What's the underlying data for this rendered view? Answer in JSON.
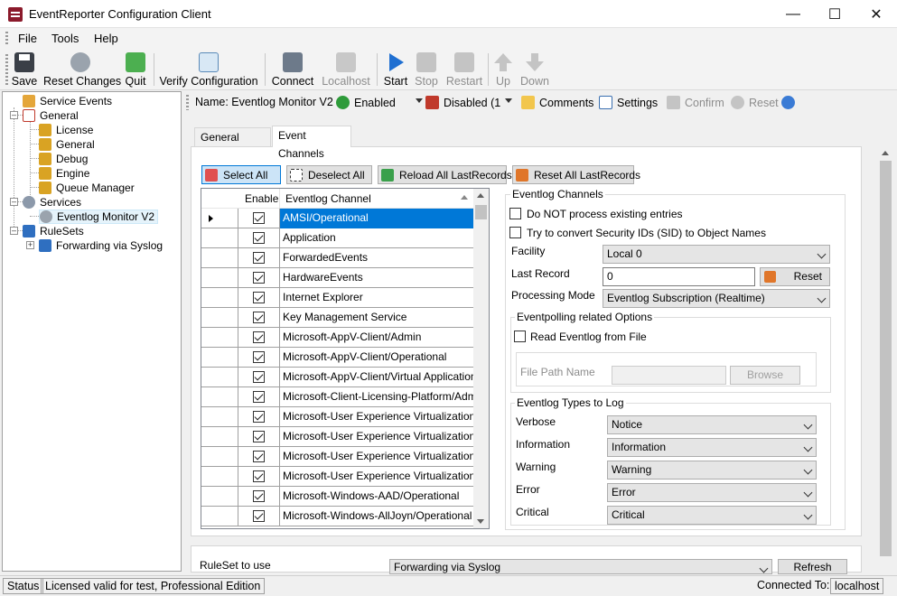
{
  "window": {
    "title": "EventReporter Configuration Client"
  },
  "menu": [
    "File",
    "Tools",
    "Help"
  ],
  "toolbar": {
    "save": "Save",
    "reset_changes": "Reset Changes",
    "quit": "Quit",
    "verify_configuration": "Verify Configuration",
    "connect": "Connect",
    "localhost": "Localhost",
    "start": "Start",
    "stop": "Stop",
    "restart": "Restart",
    "up": "Up",
    "down": "Down"
  },
  "tree": {
    "service_events": "Service Events",
    "general": "General",
    "license": "License",
    "general_child": "General",
    "debug": "Debug",
    "engine": "Engine",
    "queue_manager": "Queue Manager",
    "services": "Services",
    "eventlog_monitor": "Eventlog Monitor V2",
    "rulesets": "RuleSets",
    "forwarding": "Forwarding via Syslog"
  },
  "namebar": {
    "name": "Name: Eventlog Monitor V2",
    "enabled": "Enabled",
    "disabled": "Disabled (1",
    "comments": "Comments",
    "settings": "Settings",
    "confirm": "Confirm",
    "reset": "Reset"
  },
  "tabs": {
    "general_options": "General Options",
    "event_channels": "Event Channels"
  },
  "buttons": {
    "select_all": "Select All",
    "deselect_all": "Deselect All",
    "reload_all": "Reload All LastRecords",
    "reset_all": "Reset All LastRecords"
  },
  "grid": {
    "col_enable": "Enable",
    "col_channel": "Eventlog Channel",
    "rows": [
      "AMSI/Operational",
      "Application",
      "ForwardedEvents",
      "HardwareEvents",
      "Internet Explorer",
      "Key Management Service",
      "Microsoft-AppV-Client/Admin",
      "Microsoft-AppV-Client/Operational",
      "Microsoft-AppV-Client/Virtual Applications",
      "Microsoft-Client-Licensing-Platform/Admin",
      "Microsoft-User Experience Virtualization-A...",
      "Microsoft-User Experience Virtualization-A...",
      "Microsoft-User Experience Virtualization-I...",
      "Microsoft-User Experience Virtualization-S...",
      "Microsoft-Windows-AAD/Operational",
      "Microsoft-Windows-AllJoyn/Operational"
    ]
  },
  "channels": {
    "group_title": "Eventlog Channels",
    "do_not_process": "Do NOT process existing entries",
    "convert_sid": "Try to convert Security IDs (SID) to Object Names",
    "facility_label": "Facility",
    "facility_value": "Local 0",
    "last_record_label": "Last Record",
    "last_record_value": "0",
    "reset_btn": "Reset",
    "processing_mode_label": "Processing Mode",
    "processing_mode_value": "Eventlog Subscription (Realtime)",
    "polling_group": "Eventpolling related Options",
    "read_from_file": "Read Eventlog from File",
    "file_path_label": "File  Path Name",
    "browse": "Browse",
    "types_group": "Eventlog Types to Log",
    "types": [
      {
        "label": "Verbose",
        "value": "Notice"
      },
      {
        "label": "Information",
        "value": "Information"
      },
      {
        "label": "Warning",
        "value": "Warning"
      },
      {
        "label": "Error",
        "value": "Error"
      },
      {
        "label": "Critical",
        "value": "Critical"
      }
    ]
  },
  "ruleset": {
    "label": "RuleSet to use",
    "value": "Forwarding via Syslog",
    "refresh": "Refresh"
  },
  "status": {
    "status": "Status",
    "license": "Licensed valid for test, Professional Edition",
    "connected_to": "Connected To:",
    "host": "localhost"
  }
}
